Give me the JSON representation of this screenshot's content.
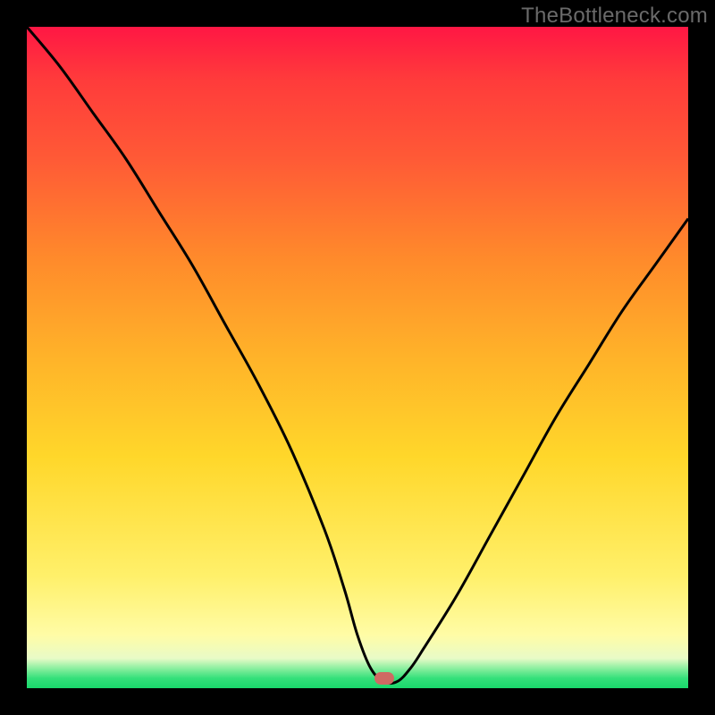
{
  "watermark": "TheBottleneck.com",
  "colors": {
    "frame": "#000000",
    "gradient_top": "#ff1744",
    "gradient_mid": "#ffd72a",
    "gradient_low": "#fffca6",
    "gradient_bottom": "#19d86c",
    "curve": "#000000",
    "marker": "#cf6a63"
  },
  "chart_data": {
    "type": "line",
    "title": "",
    "xlabel": "",
    "ylabel": "",
    "xlim": [
      0,
      100
    ],
    "ylim": [
      0,
      100
    ],
    "grid": false,
    "legend": false,
    "annotations": [
      "TheBottleneck.com"
    ],
    "marker": {
      "x": 54,
      "y": 1.5
    },
    "series": [
      {
        "name": "bottleneck-curve",
        "x": [
          0,
          5,
          10,
          15,
          20,
          25,
          30,
          35,
          40,
          45,
          48,
          50,
          52,
          54,
          56,
          58,
          60,
          65,
          70,
          75,
          80,
          85,
          90,
          95,
          100
        ],
        "values": [
          100,
          94,
          87,
          80,
          72,
          64,
          55,
          46,
          36,
          24,
          15,
          8,
          3,
          1,
          1,
          3,
          6,
          14,
          23,
          32,
          41,
          49,
          57,
          64,
          71
        ]
      }
    ]
  }
}
